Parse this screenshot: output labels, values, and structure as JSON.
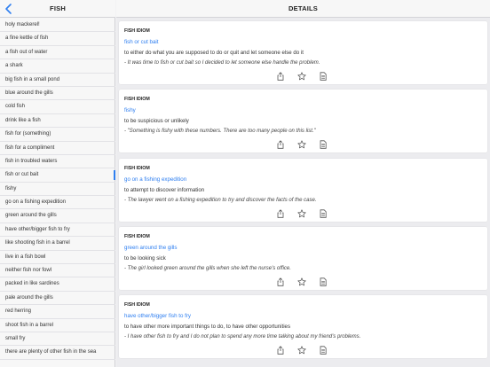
{
  "sidebar": {
    "title": "FISH",
    "items": [
      {
        "label": "holy mackerel!"
      },
      {
        "label": "a fine kettle of fish"
      },
      {
        "label": "a fish out of water"
      },
      {
        "label": "a shark"
      },
      {
        "label": "big fish in a small pond"
      },
      {
        "label": "blue around the gills"
      },
      {
        "label": "cold fish"
      },
      {
        "label": "drink like a fish"
      },
      {
        "label": "fish for (something)"
      },
      {
        "label": "fish for a compliment"
      },
      {
        "label": "fish in troubled waters"
      },
      {
        "label": "fish or cut bait",
        "selected": true
      },
      {
        "label": "fishy"
      },
      {
        "label": "go on a fishing expedition"
      },
      {
        "label": "green around the gills"
      },
      {
        "label": "have other/bigger fish to fry"
      },
      {
        "label": "like shooting fish in a barrel"
      },
      {
        "label": "live in a fish bowl"
      },
      {
        "label": "neither fish nor fowl"
      },
      {
        "label": "packed in like sardines"
      },
      {
        "label": "pale around the gills"
      },
      {
        "label": "red herring"
      },
      {
        "label": "shoot fish in a barrel"
      },
      {
        "label": "small fry"
      },
      {
        "label": "there are plenty of other fish in the sea"
      }
    ]
  },
  "main": {
    "title": "DETAILS",
    "cards": [
      {
        "category": "FISH IDIOM",
        "idiom": "fish or cut bait",
        "meaning": "to either do what you are supposed to do or quit and let someone else do it",
        "example": "- It was time to fish or cut bait so I decided to let someone else handle the problem."
      },
      {
        "category": "FISH IDIOM",
        "idiom": "fishy",
        "meaning": "to be suspicious or unlikely",
        "example": "- \"Something is fishy with these numbers. There are too many people on this list.\""
      },
      {
        "category": "FISH IDIOM",
        "idiom": "go on a fishing expedition",
        "meaning": "to attempt to discover information",
        "example": "- The lawyer went on a fishing expedition to try and discover the facts of the case."
      },
      {
        "category": "FISH IDIOM",
        "idiom": "green around the gills",
        "meaning": "to be looking sick",
        "example": "- The girl looked green around the gills when she left the nurse's office."
      },
      {
        "category": "FISH IDIOM",
        "idiom": "have other/bigger fish to fry",
        "meaning": "to have other more important things to do, to have other opportunities",
        "example": "- I have other fish to fry and I do not plan to spend any more time talking about my friend's problems."
      }
    ]
  },
  "icons": {
    "back": "chevron-left-icon",
    "share": "share-icon",
    "star": "star-icon",
    "doc": "document-icon"
  },
  "colors": {
    "accent": "#2f7ff0",
    "card_bg": "#ffffff",
    "page_bg": "#ececef"
  }
}
